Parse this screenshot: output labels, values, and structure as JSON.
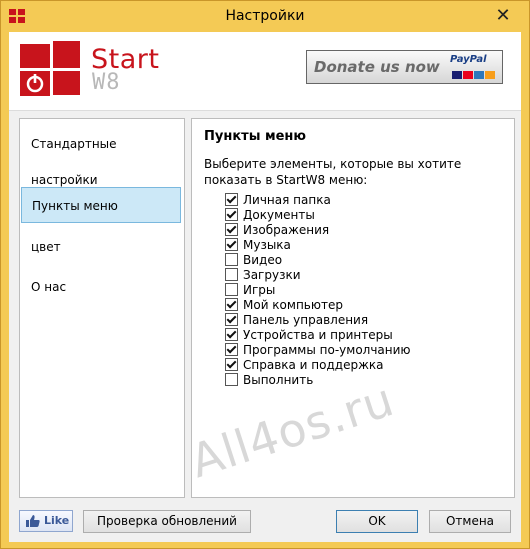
{
  "window": {
    "title": "Настройки",
    "close_glyph": "✕"
  },
  "brand": {
    "name_start": "Start",
    "name_w8": "W8",
    "accent": "#c8141c"
  },
  "donate": {
    "label": "Donate us now",
    "paypal": "PayPal"
  },
  "sidebar": {
    "items": [
      {
        "label": "Стандартные настройки"
      },
      {
        "label": "Пункты меню",
        "active": true
      },
      {
        "label": "цвет"
      },
      {
        "label": "О нас"
      }
    ]
  },
  "content": {
    "title": "Пункты меню",
    "description": "Выберите элементы, которые вы хотите показать в StartW8 меню:",
    "items": [
      {
        "label": "Личная папка",
        "checked": true
      },
      {
        "label": "Документы",
        "checked": true
      },
      {
        "label": "Изображения",
        "checked": true
      },
      {
        "label": "Музыка",
        "checked": true
      },
      {
        "label": "Видео",
        "checked": false
      },
      {
        "label": "Загрузки",
        "checked": false
      },
      {
        "label": "Игры",
        "checked": false
      },
      {
        "label": "Мой компьютер",
        "checked": true
      },
      {
        "label": "Панель управления",
        "checked": true
      },
      {
        "label": "Устройства и принтеры",
        "checked": true
      },
      {
        "label": "Программы по-умолчанию",
        "checked": true
      },
      {
        "label": "Справка и поддержка",
        "checked": true
      },
      {
        "label": "Выполнить",
        "checked": false
      }
    ]
  },
  "watermark": "All4os.ru",
  "footer": {
    "like": "Like",
    "check_updates": "Проверка обновлений",
    "ok": "OK",
    "cancel": "Отмена"
  }
}
